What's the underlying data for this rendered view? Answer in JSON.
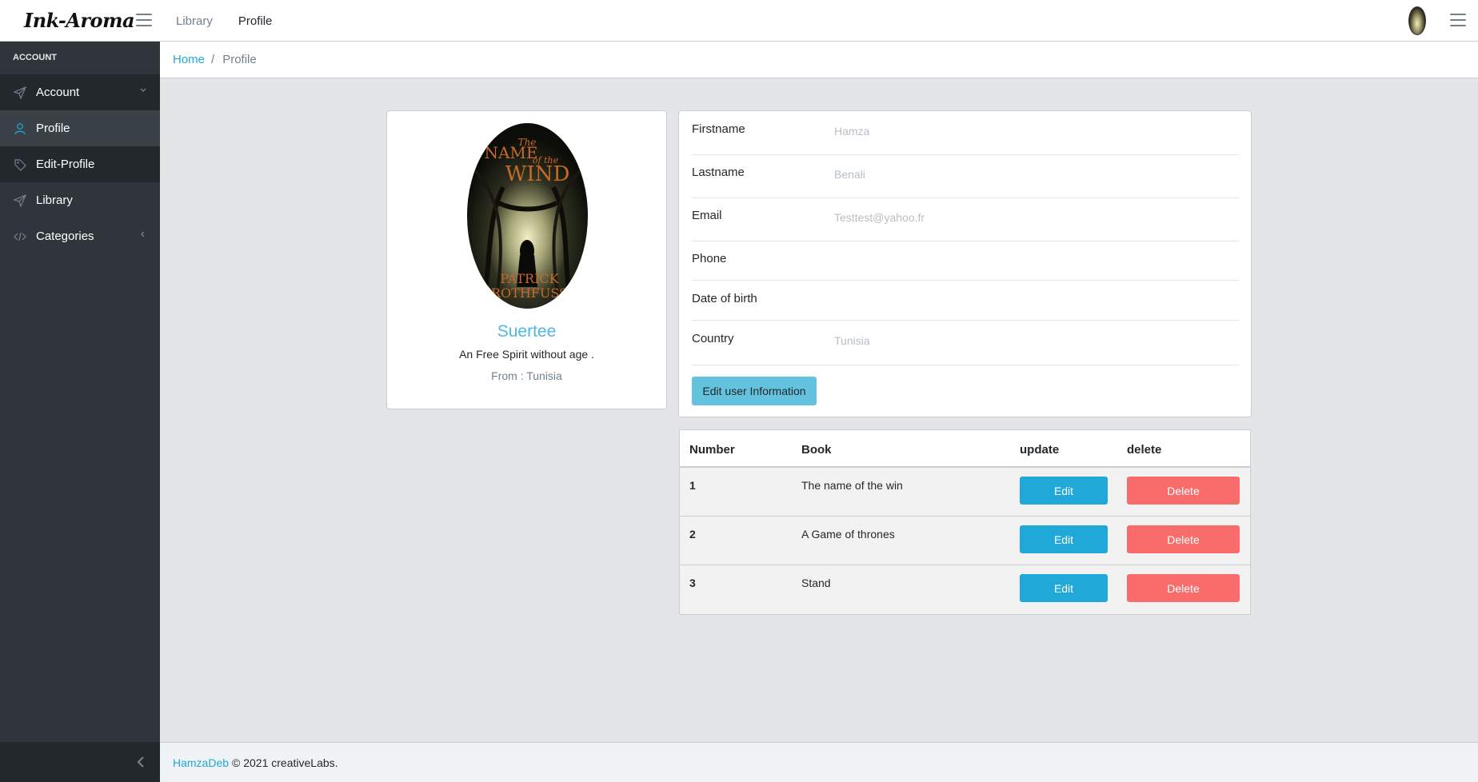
{
  "brand": {
    "name": "Ink-Aroma"
  },
  "header": {
    "nav": [
      {
        "label": "Library"
      },
      {
        "label": "Profile"
      }
    ]
  },
  "sidebar": {
    "title": "ACCOUNT",
    "items": [
      {
        "label": "Account",
        "icon": "paper-plane-icon"
      },
      {
        "label": "Profile",
        "icon": "user-icon"
      },
      {
        "label": "Edit-Profile",
        "icon": "tag-icon"
      },
      {
        "label": "Library",
        "icon": "paper-plane-icon"
      },
      {
        "label": "Categories",
        "icon": "code-icon"
      }
    ]
  },
  "breadcrumb": {
    "home": "Home",
    "separator": "/",
    "current": "Profile"
  },
  "profile": {
    "cover_title_line1": "The",
    "cover_title_line2": "NAME",
    "cover_title_line3": "of the",
    "cover_title_line4": "WIND",
    "cover_author_line1": "PATRICK",
    "cover_author_line2": "ROTHFUSS",
    "name": "Suertee",
    "bio": "An Free Spirit without age .",
    "from": "From : Tunisia"
  },
  "info": {
    "fields": [
      {
        "label": "Firstname",
        "value": "Hamza"
      },
      {
        "label": "Lastname",
        "value": "Benali"
      },
      {
        "label": "Email",
        "value": "Testtest@yahoo.fr"
      },
      {
        "label": "Phone",
        "value": ""
      },
      {
        "label": "Date of birth",
        "value": ""
      },
      {
        "label": "Country",
        "value": "Tunisia"
      }
    ],
    "edit_button": "Edit user Information"
  },
  "table": {
    "headers": {
      "number": "Number",
      "book": "Book",
      "update": "update",
      "delete": "delete"
    },
    "rows": [
      {
        "number": "1",
        "book": "The name of the win",
        "edit": "Edit",
        "delete": "Delete"
      },
      {
        "number": "2",
        "book": "A Game of thrones",
        "edit": "Edit",
        "delete": "Delete"
      },
      {
        "number": "3",
        "book": "Stand",
        "edit": "Edit",
        "delete": "Delete"
      }
    ]
  },
  "footer": {
    "author": "HamzaDeb",
    "copyright": "© 2021 creativeLabs."
  },
  "colors": {
    "primary": "#20a8d8",
    "info": "#63c2de",
    "danger": "#f86c6b",
    "sidebar": "#2f353a"
  }
}
